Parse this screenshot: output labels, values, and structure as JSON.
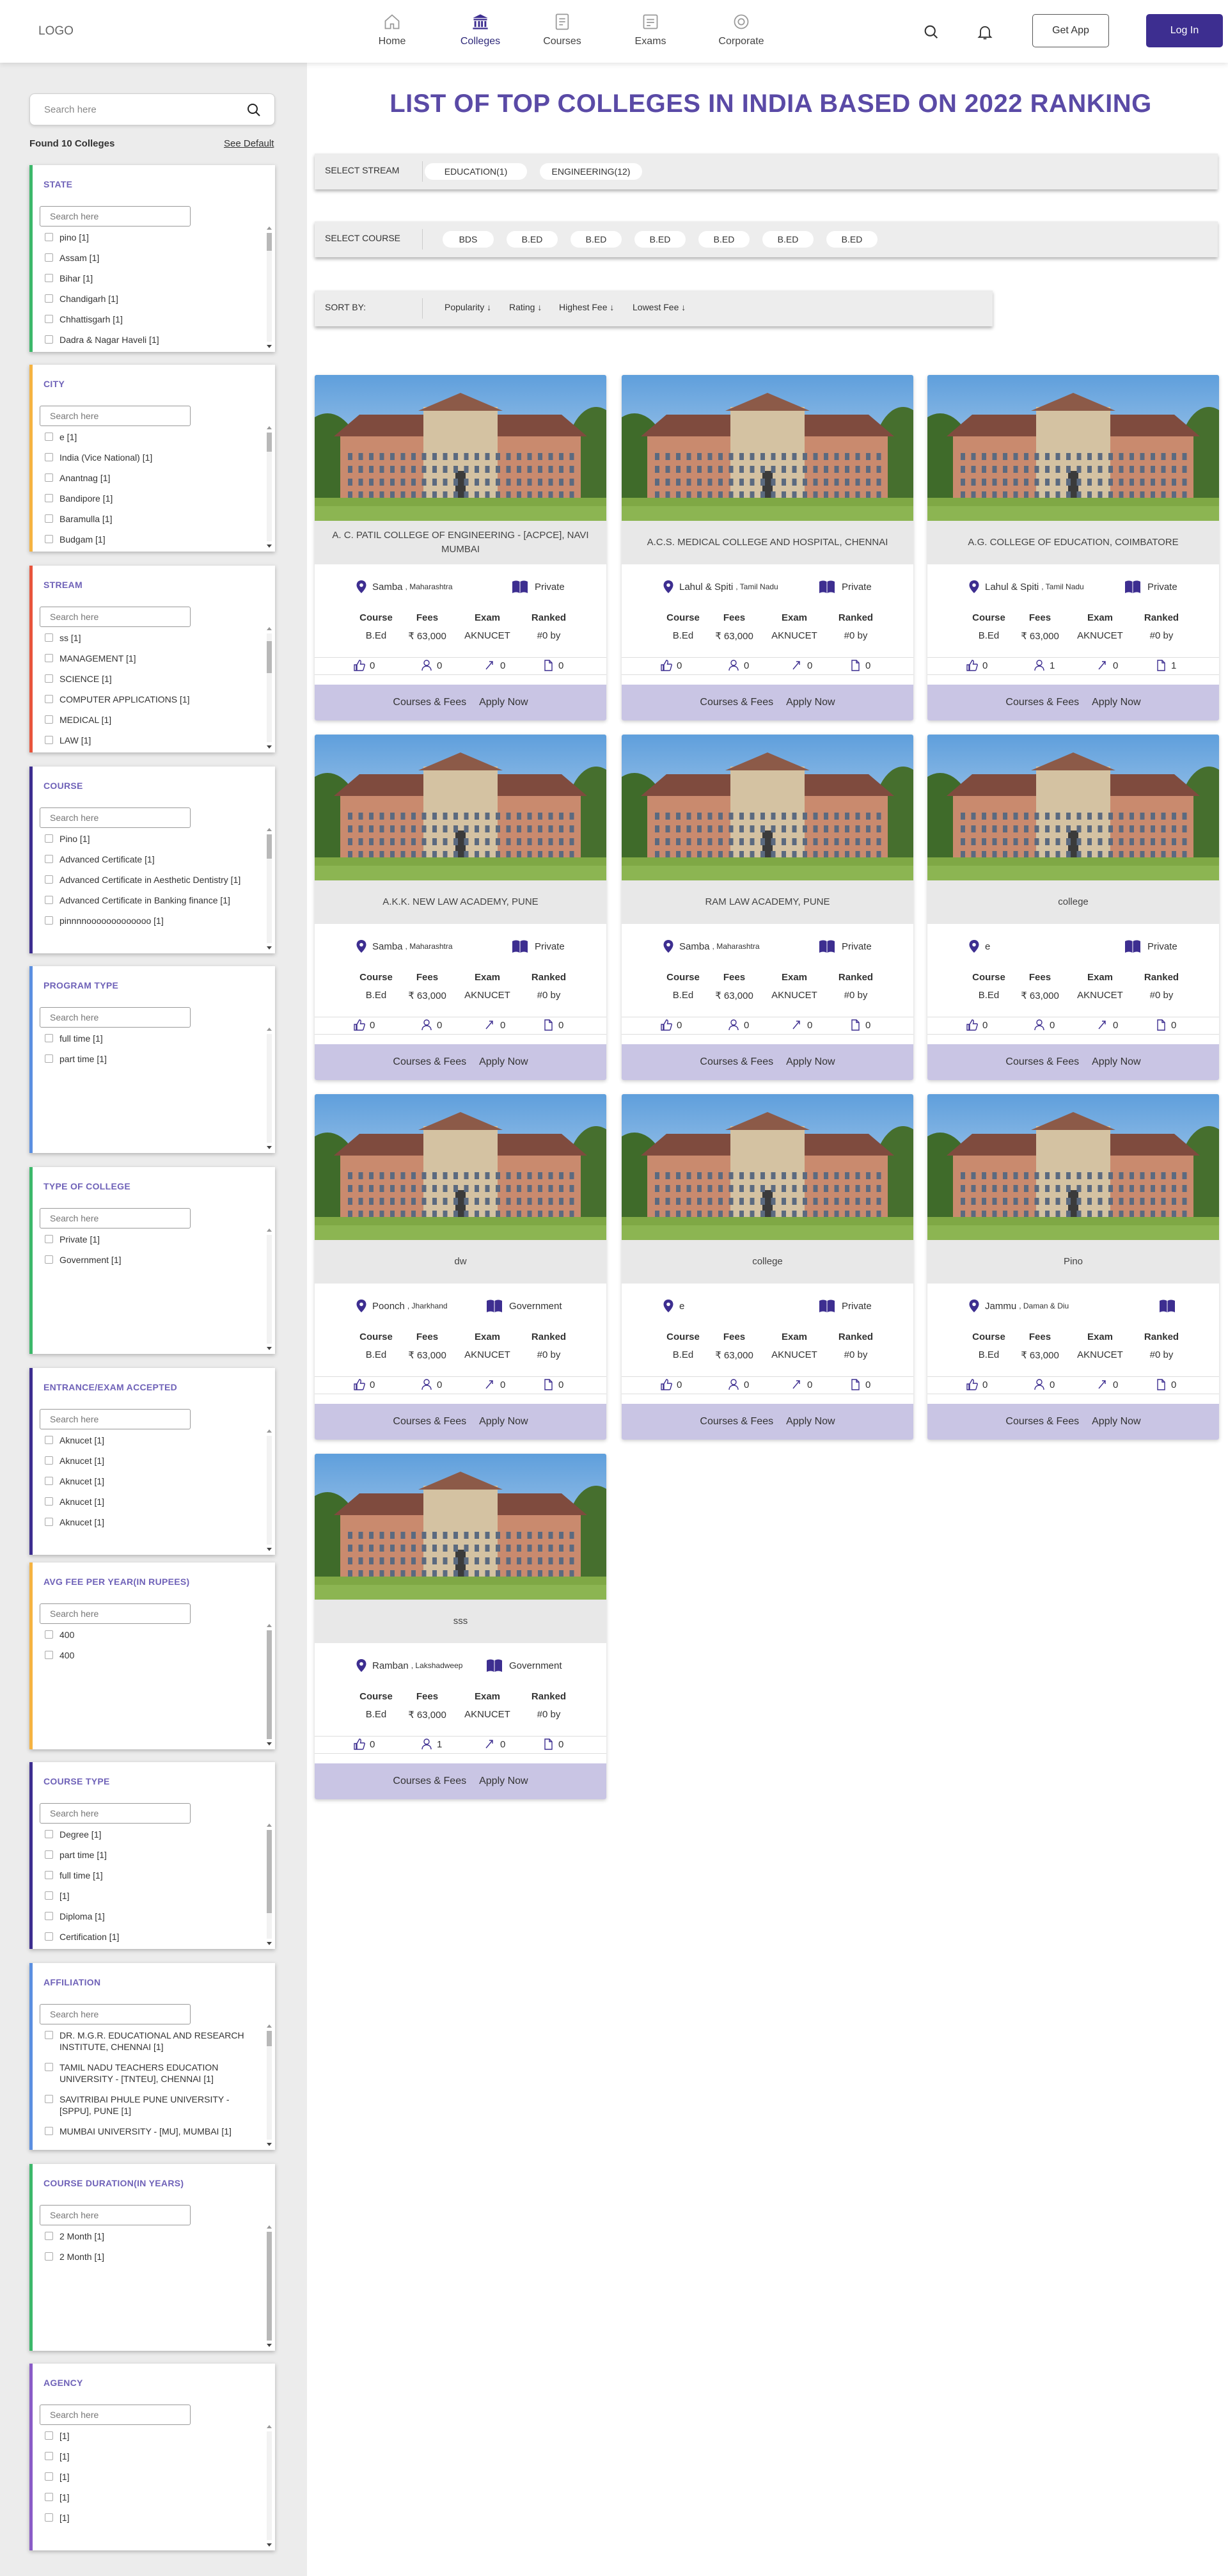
{
  "header": {
    "logo": "LOGO",
    "nav": [
      {
        "label": "Home",
        "icon": "home-icon"
      },
      {
        "label": "Colleges",
        "icon": "college-icon"
      },
      {
        "label": "Courses",
        "icon": "course-icon"
      },
      {
        "label": "Exams",
        "icon": "exam-icon"
      },
      {
        "label": "Corporate",
        "icon": "corporate-icon"
      }
    ],
    "active_nav": "Colleges",
    "get_app": "Get App",
    "login": "Log In"
  },
  "sidebar": {
    "search_placeholder": "Search here",
    "found": "Found 10 Colleges",
    "see_default": "See Default",
    "filters": [
      {
        "title": "STATE",
        "color": "#3db86b",
        "placeholder": "Search here",
        "items": [
          "pino [1]",
          "Assam [1]",
          "Bihar [1]",
          "Chandigarh [1]",
          "Chhattisgarh [1]",
          "Dadra & Nagar Haveli [1]"
        ]
      },
      {
        "title": "CITY",
        "color": "#f5b342",
        "placeholder": "Search here",
        "items": [
          "e [1]",
          "India (Vice National) [1]",
          "Anantnag [1]",
          "Bandipore [1]",
          "Baramulla [1]",
          "Budgam [1]"
        ]
      },
      {
        "title": "STREAM",
        "color": "#e8553d",
        "placeholder": "Search here",
        "items": [
          "ss [1]",
          "MANAGEMENT [1]",
          "SCIENCE [1]",
          "COMPUTER APPLICATIONS [1]",
          "MEDICAL [1]",
          "LAW [1]"
        ]
      },
      {
        "title": "COURSE",
        "color": "#3d2e90",
        "placeholder": "Search here",
        "items": [
          "Pino [1]",
          "Advanced Certificate [1]",
          "Advanced Certificate in Aesthetic Dentistry [1]",
          "Advanced Certificate in Banking finance [1]",
          "pinnnnooooooooooooo [1]"
        ]
      },
      {
        "title": "PROGRAM TYPE",
        "color": "#5b8fe0",
        "placeholder": "Search here",
        "items": [
          "full time [1]",
          "part time [1]"
        ]
      },
      {
        "title": "TYPE OF COLLEGE",
        "color": "#3db86b",
        "placeholder": "Search here",
        "items": [
          "Private [1]",
          "Government [1]"
        ]
      },
      {
        "title": "ENTRANCE/EXAM ACCEPTED",
        "color": "#3d2e90",
        "placeholder": "Search here",
        "items": [
          "Aknucet [1]",
          "Aknucet [1]",
          "Aknucet [1]",
          "Aknucet [1]",
          "Aknucet [1]"
        ]
      },
      {
        "title": "AVG FEE PER YEAR(IN RUPEES)",
        "color": "#f5b342",
        "placeholder": "Search here",
        "items": [
          "400",
          "400"
        ]
      },
      {
        "title": "COURSE TYPE",
        "color": "#3d2e90",
        "placeholder": "Search here",
        "items": [
          "Degree [1]",
          "part time [1]",
          "full time [1]",
          "[1]",
          "Diploma [1]",
          "Certification [1]"
        ]
      },
      {
        "title": "AFFILIATION",
        "color": "#5b8fe0",
        "placeholder": "Search here",
        "items": [
          "DR. M.G.R. EDUCATIONAL AND RESEARCH INSTITUTE, CHENNAI [1]",
          "TAMIL NADU TEACHERS EDUCATION UNIVERSITY - [TNTEU], CHENNAI [1]",
          "SAVITRIBAI PHULE PUNE UNIVERSITY - [SPPU], PUNE [1]",
          "MUMBAI UNIVERSITY - [MU], MUMBAI [1]"
        ]
      },
      {
        "title": "COURSE DURATION(IN YEARS)",
        "color": "#3db86b",
        "placeholder": "Search here",
        "items": [
          "2 Month [1]",
          "2 Month [1]"
        ]
      },
      {
        "title": "AGENCY",
        "color": "#8a5cc7",
        "placeholder": "Search here",
        "items": [
          "[1]",
          "[1]",
          "[1]",
          "[1]",
          "[1]"
        ]
      }
    ]
  },
  "main": {
    "title": "LIST OF TOP COLLEGES IN INDIA BASED ON 2022 RANKING",
    "stream_label": "SELECT STREAM",
    "streams": [
      "EDUCATION(1)",
      "ENGINEERING(12)"
    ],
    "course_label": "SELECT COURSE",
    "courses": [
      "BDS",
      "B.ED",
      "B.ED",
      "B.ED",
      "B.ED",
      "B.ED",
      "B.ED"
    ],
    "sort_label": "SORT BY:",
    "sort_options": [
      "Popularity ↓",
      "Rating ↓",
      "Highest Fee ↓",
      "Lowest Fee ↓"
    ]
  },
  "card_labels": {
    "course": "Course",
    "fees": "Fees",
    "exam": "Exam",
    "ranked": "Ranked",
    "courses_fees": "Courses & Fees",
    "apply": "Apply Now"
  },
  "colleges": [
    {
      "name": "A. C. PATIL COLLEGE OF ENGINEERING - [ACPCE], NAVI MUMBAI",
      "city": "Samba",
      "state": ", Maharashtra",
      "ownership": "Private",
      "course": "B.Ed",
      "fees": "₹ 63,000",
      "exam": "AKNUCET",
      "ranked": "#0 by",
      "likes": "0",
      "users": "0",
      "shares": "0",
      "docs": "0"
    },
    {
      "name": "A.C.S. MEDICAL COLLEGE AND HOSPITAL, CHENNAI",
      "city": "Lahul & Spiti",
      "state": ", Tamil Nadu",
      "ownership": "Private",
      "course": "B.Ed",
      "fees": "₹ 63,000",
      "exam": "AKNUCET",
      "ranked": "#0 by",
      "likes": "0",
      "users": "0",
      "shares": "0",
      "docs": "0"
    },
    {
      "name": "A.G. COLLEGE OF EDUCATION, COIMBATORE",
      "city": "Lahul & Spiti",
      "state": ", Tamil Nadu",
      "ownership": "Private",
      "course": "B.Ed",
      "fees": "₹ 63,000",
      "exam": "AKNUCET",
      "ranked": "#0 by",
      "likes": "0",
      "users": "1",
      "shares": "0",
      "docs": "1"
    },
    {
      "name": "A.K.K. NEW LAW ACADEMY, PUNE",
      "city": "Samba",
      "state": ", Maharashtra",
      "ownership": "Private",
      "course": "B.Ed",
      "fees": "₹ 63,000",
      "exam": "AKNUCET",
      "ranked": "#0 by",
      "likes": "0",
      "users": "0",
      "shares": "0",
      "docs": "0"
    },
    {
      "name": "RAM LAW ACADEMY, PUNE",
      "city": "Samba",
      "state": ", Maharashtra",
      "ownership": "Private",
      "course": "B.Ed",
      "fees": "₹ 63,000",
      "exam": "AKNUCET",
      "ranked": "#0 by",
      "likes": "0",
      "users": "0",
      "shares": "0",
      "docs": "0"
    },
    {
      "name": "college",
      "city": "e",
      "state": "",
      "ownership": "Private",
      "course": "B.Ed",
      "fees": "₹ 63,000",
      "exam": "AKNUCET",
      "ranked": "#0 by",
      "likes": "0",
      "users": "0",
      "shares": "0",
      "docs": "0"
    },
    {
      "name": "dw",
      "city": "Poonch",
      "state": ", Jharkhand",
      "ownership": "Government",
      "course": "B.Ed",
      "fees": "₹ 63,000",
      "exam": "AKNUCET",
      "ranked": "#0 by",
      "likes": "0",
      "users": "0",
      "shares": "0",
      "docs": "0"
    },
    {
      "name": "college",
      "city": "e",
      "state": "",
      "ownership": "Private",
      "course": "B.Ed",
      "fees": "₹ 63,000",
      "exam": "AKNUCET",
      "ranked": "#0 by",
      "likes": "0",
      "users": "0",
      "shares": "0",
      "docs": "0"
    },
    {
      "name": "Pino",
      "city": "Jammu",
      "state": ", Daman & Diu",
      "ownership": "",
      "course": "B.Ed",
      "fees": "₹ 63,000",
      "exam": "AKNUCET",
      "ranked": "#0 by",
      "likes": "0",
      "users": "0",
      "shares": "0",
      "docs": "0"
    },
    {
      "name": "sss",
      "city": "Ramban",
      "state": ", Lakshadweep",
      "ownership": "Government",
      "course": "B.Ed",
      "fees": "₹ 63,000",
      "exam": "AKNUCET",
      "ranked": "#0 by",
      "likes": "0",
      "users": "1",
      "shares": "0",
      "docs": "0"
    }
  ],
  "colors": {
    "brand": "#3d2e90",
    "title": "#5a4aa6",
    "card_footer": "#c9c5e4"
  }
}
